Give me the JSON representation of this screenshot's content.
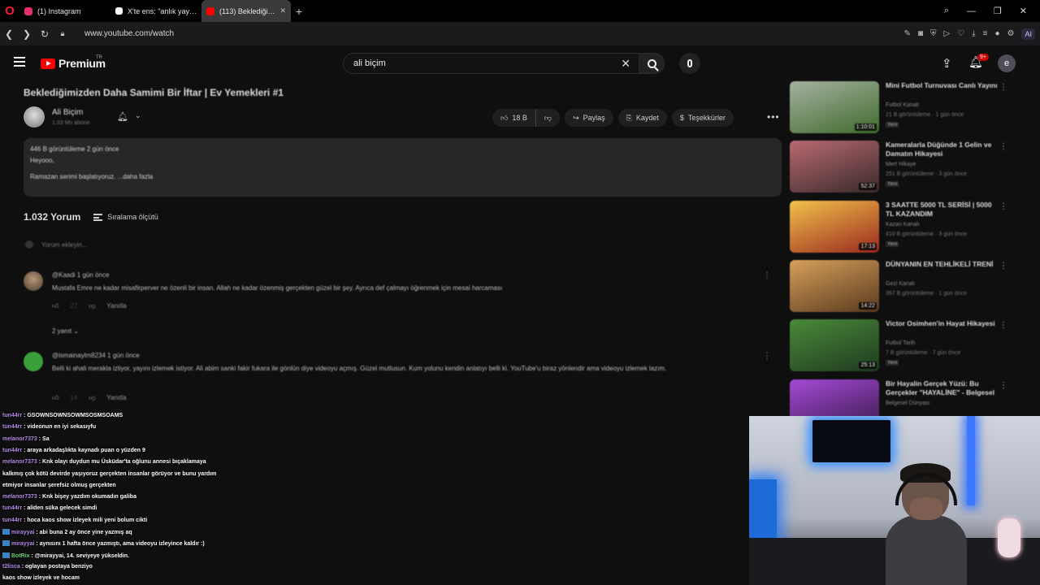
{
  "browser": {
    "tabs": [
      {
        "label": "(1) Instagram",
        "active": false,
        "color": "#e1306c"
      },
      {
        "label": "X'te ens: \"anlık yayın var :",
        "active": false,
        "color": "#ffffff"
      },
      {
        "label": "(113) Beklediğimizden",
        "active": true,
        "color": "#ff0000"
      }
    ],
    "url": "www.youtube.com/watch",
    "ai_label": "AI"
  },
  "youtube": {
    "logo_text": "Premium",
    "region": "TR",
    "search_value": "ali biçim",
    "avatar_letter": "e",
    "notification_badge": "9+"
  },
  "video": {
    "title": "Beklediğimizden Daha Samimi Bir İftar | Ev Yemekleri #1",
    "channel_name": "Ali Biçim",
    "channel_subs": "1,03 Mn abone",
    "like_count": "18 B",
    "share_label": "Paylaş",
    "save_label": "Kaydet",
    "thanks_label": "Teşekkürler",
    "description": {
      "meta": "446 B görüntüleme  2 gün önce",
      "line2": "Heyooo,",
      "line3": "Ramazan serimi başlatıyoruz. ...daha fazla"
    }
  },
  "comments": {
    "count_label": "1.032 Yorum",
    "sort_label": "Sıralama ölçütü",
    "add_placeholder": "Yorum ekleyin...",
    "items": [
      {
        "user": "@Kaadi  1 gün önce",
        "text": "Mustafa Emre ne kadar misafirperver ne özenli bir insan. Allah ne kadar özenmiş gerçekten güzel bir şey. Ayrıca def çalmayı öğrenmek için mesai harcaması",
        "likes": "27",
        "reply": "Yanıtla",
        "replies": "2 yanıt"
      },
      {
        "user": "@ismainaylm8234  1 gün önce",
        "text": "Belli ki ahali merakla izliyor, yayını izlemek istiyor. Ali abim sanki fakir fukara ile gönlün diye videoyu açmış. Güzel mutlusun. Kum yolunu kendin anlatıyı belli ki. YouTube'u biraz yönlendir ama videoyu izlemek lazım.",
        "likes": "14",
        "reply": "Yanıtla"
      }
    ]
  },
  "sidebar": [
    {
      "title": "Mini Futbol Turnuvası Canlı Yayını",
      "channel": "Futbol Kanalı",
      "meta": "21 B görüntüleme · 1 gün önce",
      "new": "Yeni",
      "duration": "1:10:01",
      "c1": "#3f6b2d",
      "c2": "#a6b1a0"
    },
    {
      "title": "Kameralarla Düğünde 1 Gelin ve Damatın Hikayesi",
      "channel": "Mert Hikaye",
      "meta": "251 B görüntüleme · 3 gün önce",
      "new": "Yeni",
      "duration": "52:37",
      "c1": "#3a2a2a",
      "c2": "#b86a72"
    },
    {
      "title": "3 SAATTE 5000 TL SERİSİ | 5000 TL KAZANDIM",
      "channel": "Kazan Kanalı",
      "meta": "410 B görüntüleme · 3 gün önce",
      "new": "Yeni",
      "duration": "17:13",
      "c1": "#9a2a1f",
      "c2": "#f2c14a"
    },
    {
      "title": "DÜNYANIN EN TEHLİKELİ TRENİ",
      "channel": "Gezi Kanalı",
      "meta": "357 B görüntüleme · 1 gün önce",
      "new": "",
      "duration": "14:22",
      "c1": "#5a3a1f",
      "c2": "#d6a05a"
    },
    {
      "title": "Victor Osimhen'in Hayat Hikayesi",
      "channel": "Futbol Tarih",
      "meta": "7 B görüntüleme · 7 gün önce",
      "new": "Yeni",
      "duration": "25:13",
      "c1": "#1f3a1f",
      "c2": "#4a8a3a"
    },
    {
      "title": "Bir Hayalin Gerçek Yüzü: Bu Gerçekler \"HAYALİNE\" - Belgesel",
      "channel": "Belgesel Dünyası",
      "meta": "",
      "new": "",
      "duration": "",
      "c1": "#3a1a4a",
      "c2": "#a44ad6"
    }
  ],
  "chat": [
    {
      "user": "tun44rr",
      "msg": "GSOWNSOWNSOWMSOSMSOAMS",
      "color": "purple"
    },
    {
      "user": "tun44rr",
      "msg": "videonun en iyi sekasıyfu",
      "color": "purple"
    },
    {
      "user": "melanor7373",
      "msg": "Sa",
      "color": "purple"
    },
    {
      "user": "tun44rr",
      "msg": "araya arkadaşlıkta kaynadı puan o yüzden 9",
      "color": "purple"
    },
    {
      "user": "melanor7373",
      "msg": "Knk olayı duydun mu Üsküdar'ta oğlunu annesi bıçaklamaya",
      "color": "purple"
    },
    {
      "user": "",
      "msg": "kalkmış çok kötü devirde yaşıyoruz gerçekten insanlar görüyor ve bunu yardım",
      "color": "purple"
    },
    {
      "user": "",
      "msg": "etmiyor insanlar şerefsiz olmuş gerçekten",
      "color": "purple"
    },
    {
      "user": "melanor7373",
      "msg": "Knk bişey yazdım okumadın galiba",
      "color": "purple"
    },
    {
      "user": "tun44rr",
      "msg": "aliden süka gelecek simdi",
      "color": "purple"
    },
    {
      "user": "tun44rr",
      "msg": "hoca kaos show izleyek mili yeni bolum cikti",
      "color": "purple"
    },
    {
      "user": "mirayyai",
      "msg": "abi buna 2 ay önce yine yazmış aq",
      "color": "purple"
    },
    {
      "user": "mirayyai",
      "msg": "aynısını 1 hafta önce yazmıştı, ama videoyu izleyince kaldır :)",
      "color": "purple"
    },
    {
      "user": "BotRix",
      "msg": "@mirayyai, 14. seviyeye yükseldin.",
      "color": "green"
    },
    {
      "user": "t2lisca",
      "msg": "oglayan postaya benziyo",
      "color": "purple"
    },
    {
      "user": "",
      "msg": "kaos show izleyek ve hocam",
      "color": "purple"
    }
  ]
}
